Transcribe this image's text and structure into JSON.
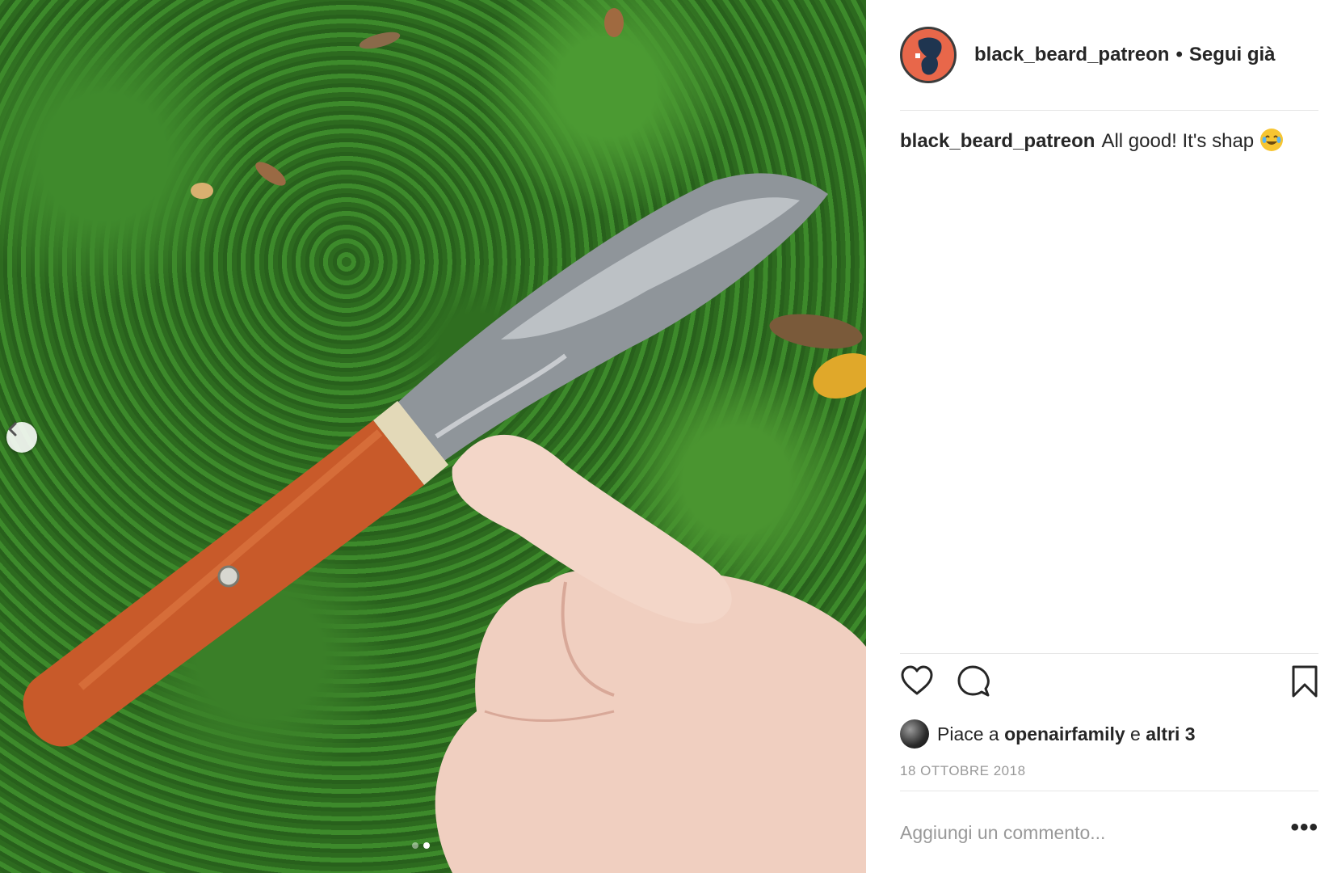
{
  "post": {
    "image_alt": "",
    "carousel": {
      "prev_icon": "chevron-left-icon",
      "total_slides": 2,
      "active_slide": 2
    }
  },
  "header": {
    "username": "black_beard_patreon",
    "separator": "•",
    "follow_status": "Segui già",
    "avatar_color": "#e8674a"
  },
  "caption": {
    "username": "black_beard_patreon",
    "text": "All good! It's shap",
    "emoji": "tears-of-joy-emoji"
  },
  "actions": {
    "like_icon": "heart-icon",
    "comment_icon": "comment-icon",
    "save_icon": "bookmark-icon"
  },
  "likes": {
    "prefix": "Piace a",
    "user": "openairfamily",
    "joiner": "e",
    "others": "altri 3"
  },
  "date": "18 OTTOBRE 2018",
  "comment": {
    "placeholder": "Aggiungi un commento...",
    "more_label": "•••",
    "more_icon": "more-options-icon"
  },
  "colors": {
    "text": "#262626",
    "muted": "#999999",
    "divider": "#e6e6e6",
    "grass": "#346f24",
    "wood": "#c85a2a"
  }
}
